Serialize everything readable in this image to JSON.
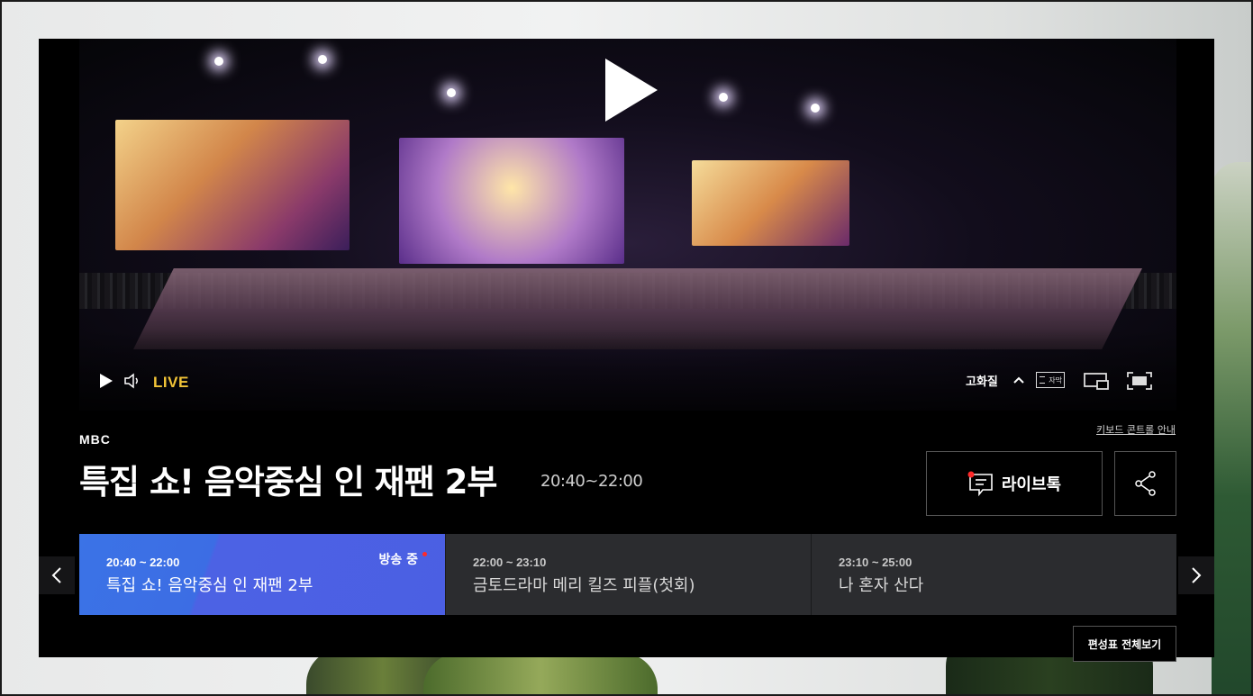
{
  "player": {
    "live_label": "LIVE",
    "quality_label": "고화질",
    "subtitle_label": "자막"
  },
  "program": {
    "channel": "MBC",
    "title": "특집 쇼! 음악중심 인 재팬 2부",
    "time": "20:40~22:00",
    "keyboard_guide": "키보드 콘트롤 안내",
    "livetalk_label": "라이브톡"
  },
  "schedule": {
    "items": [
      {
        "time": "20:40 ~ 22:00",
        "title": "특집 쇼! 음악중심 인 재팬 2부",
        "status": "방송 중"
      },
      {
        "time": "22:00 ~ 23:10",
        "title": "금토드라마 메리 킬즈 피플(첫회)"
      },
      {
        "time": "23:10 ~ 25:00",
        "title": "나 혼자 산다"
      }
    ],
    "full_schedule_label": "편성표 전체보기"
  },
  "colors": {
    "live_accent": "#f2c437",
    "active_slot": "#3c6de4",
    "onair_dot": "#ff2a2a"
  }
}
